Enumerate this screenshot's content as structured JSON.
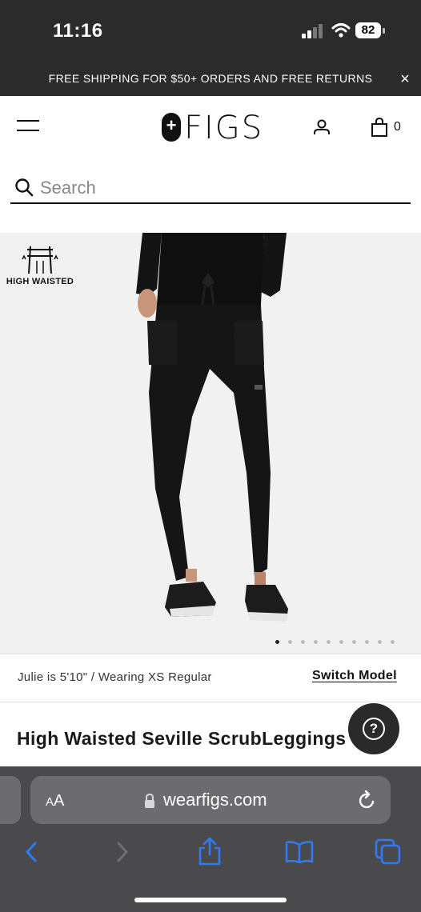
{
  "status_bar": {
    "time": "11:16",
    "battery": "82"
  },
  "promo": {
    "text": "FREE SHIPPING FOR $50+ ORDERS AND FREE RETURNS",
    "close_icon": "×"
  },
  "header": {
    "logo_plus": "+",
    "logo_text": "FIGS",
    "bag_count": "0"
  },
  "search": {
    "placeholder": "Search"
  },
  "product": {
    "badge_label": "HIGH WAISTED",
    "image_count": 10,
    "active_image": 1,
    "model_info": "Julie is 5'10\" / Wearing XS Regular",
    "switch_model": "Switch Model",
    "title": "High Waisted Seville ScrubLeggings"
  },
  "help": {
    "label": "?"
  },
  "browser": {
    "aa_big": "A",
    "aa_small": "A",
    "url": "wearfigs.com"
  },
  "colors": {
    "dark_bar": "#2b2b2b",
    "browser_bg": "#4a4a4c",
    "ios_blue": "#2f7bf6",
    "product_bg": "#f1f1f1"
  },
  "icons": [
    "hamburger-icon",
    "account-icon",
    "shopping-bag-icon",
    "search-icon",
    "high-waisted-icon",
    "help-icon",
    "lock-icon",
    "reload-icon",
    "back-icon",
    "forward-icon",
    "share-icon",
    "bookmarks-icon",
    "tabs-icon"
  ]
}
